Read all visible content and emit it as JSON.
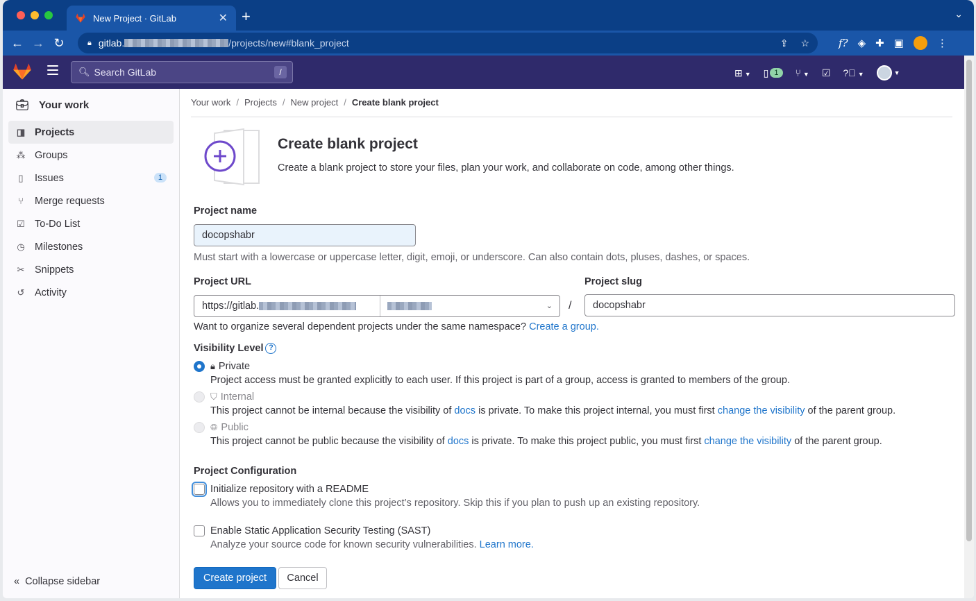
{
  "browser": {
    "tab_title": "New Project · GitLab",
    "tab_close": "✕",
    "new_tab": "+",
    "url_host": "gitlab.",
    "url_path": "/projects/new#blank_project"
  },
  "topbar": {
    "search_placeholder": "Search GitLab",
    "search_shortcut": "/",
    "mr_count": "1"
  },
  "sidebar": {
    "header": "Your work",
    "items": [
      {
        "label": "Projects",
        "active": true
      },
      {
        "label": "Groups"
      },
      {
        "label": "Issues",
        "count": "1"
      },
      {
        "label": "Merge requests"
      },
      {
        "label": "To-Do List"
      },
      {
        "label": "Milestones"
      },
      {
        "label": "Snippets"
      },
      {
        "label": "Activity"
      }
    ],
    "collapse": "Collapse sidebar"
  },
  "breadcrumb": [
    "Your work",
    "Projects",
    "New project",
    "Create blank project"
  ],
  "page": {
    "title": "Create blank project",
    "description": "Create a blank project to store your files, plan your work, and collaborate on code, among other things."
  },
  "form": {
    "project_name_label": "Project name",
    "project_name_value": "docopshabr",
    "project_name_help": "Must start with a lowercase or uppercase letter, digit, emoji, or underscore. Can also contain dots, pluses, dashes, or spaces.",
    "project_url_label": "Project URL",
    "project_url_prefix": "https://gitlab.",
    "url_separator": "/",
    "project_slug_label": "Project slug",
    "project_slug_value": "docopshabr",
    "namespace_help": "Want to organize several dependent projects under the same namespace?",
    "namespace_link": "Create a group.",
    "visibility_label": "Visibility Level",
    "visibility": {
      "private_label": "Private",
      "private_desc": "Project access must be granted explicitly to each user. If this project is part of a group, access is granted to members of the group.",
      "internal_label": "Internal",
      "internal_desc_1": "This project cannot be internal because the visibility of",
      "internal_link_1": "docs",
      "internal_desc_2": "is private. To make this project internal, you must first",
      "internal_link_2": "change the visibility",
      "internal_desc_3": "of the parent group.",
      "public_label": "Public",
      "public_desc_1": "This project cannot be public because the visibility of",
      "public_link_1": "docs",
      "public_desc_2": "is private. To make this project public, you must first",
      "public_link_2": "change the visibility",
      "public_desc_3": "of the parent group.",
      "selected": "private"
    },
    "config_label": "Project Configuration",
    "readme_label": "Initialize repository with a README",
    "readme_desc": "Allows you to immediately clone this project’s repository. Skip this if you plan to push up an existing repository.",
    "sast_label": "Enable Static Application Security Testing (SAST)",
    "sast_desc": "Analyze your source code for known security vulnerabilities.",
    "sast_link": "Learn more.",
    "create_button": "Create project",
    "cancel_button": "Cancel"
  },
  "colors": {
    "gitlab_topbar": "#2f2a6b",
    "browser_frame": "#0b3f86",
    "primary": "#1f75cb",
    "tanuki": "#e24329"
  },
  "icons": {
    "browser": [
      "back-icon",
      "forward-icon",
      "reload-icon",
      "lock-icon",
      "share-icon",
      "bookmark-star-icon",
      "extension-icon",
      "profile-icon",
      "kebab-menu-icon"
    ],
    "topbar": [
      "gitlab-logo",
      "hamburger-menu-icon",
      "search-icon",
      "plus-square-icon",
      "issues-icon",
      "merge-request-icon",
      "todo-icon",
      "help-icon",
      "user-avatar"
    ]
  }
}
